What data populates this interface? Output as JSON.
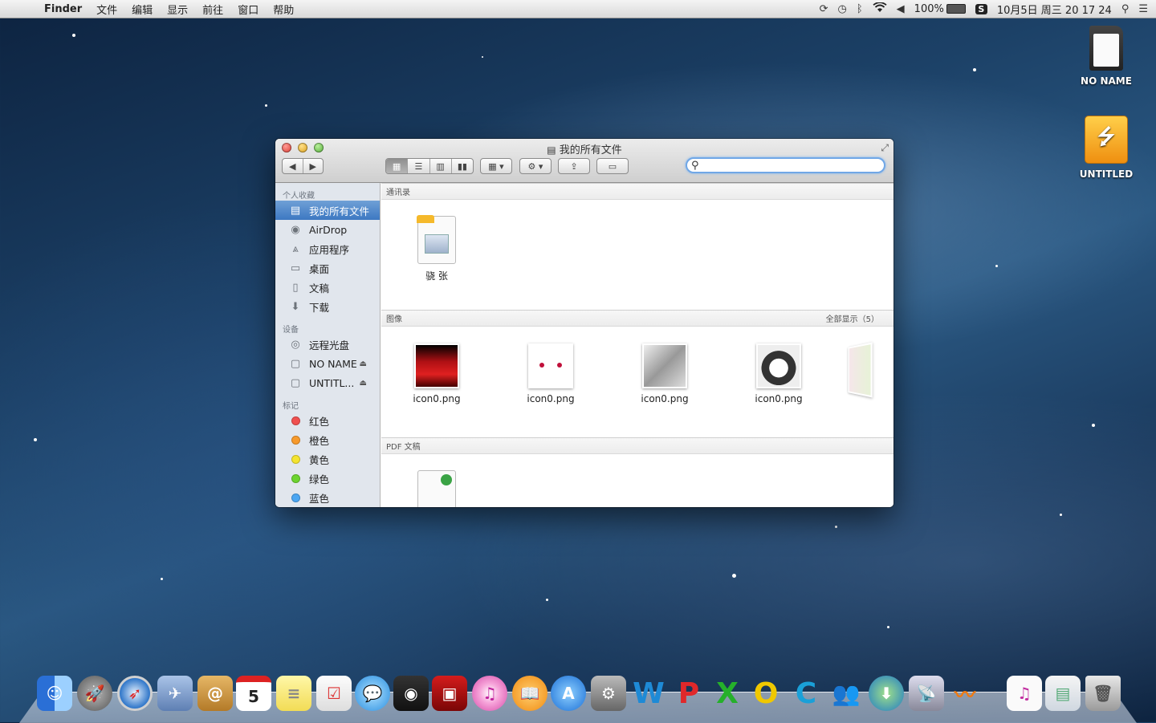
{
  "menubar": {
    "apple_glyph": "",
    "app_name": "Finder",
    "menus": [
      "文件",
      "编辑",
      "显示",
      "前往",
      "窗口",
      "帮助"
    ],
    "battery": "100%",
    "datetime": "10月5日 周三  20 17 24"
  },
  "desktop": {
    "drives": [
      {
        "label": "NO NAME",
        "icon": "sd-card-icon"
      },
      {
        "label": "UNTITLED",
        "icon": "usb-drive-icon"
      }
    ]
  },
  "finder": {
    "title": "我的所有文件",
    "search": {
      "value": "",
      "placeholder": ""
    },
    "sidebar": {
      "favorites_header": "个人收藏",
      "favorites": [
        {
          "label": "我的所有文件",
          "icon": "all-files-icon",
          "selected": true
        },
        {
          "label": "AirDrop",
          "icon": "airdrop-icon"
        },
        {
          "label": "应用程序",
          "icon": "applications-icon"
        },
        {
          "label": "桌面",
          "icon": "desktop-icon"
        },
        {
          "label": "文稿",
          "icon": "documents-icon"
        },
        {
          "label": "下载",
          "icon": "downloads-icon"
        }
      ],
      "devices_header": "设备",
      "devices": [
        {
          "label": "远程光盘",
          "icon": "remote-disc-icon"
        },
        {
          "label": "NO NAME",
          "icon": "drive-icon",
          "eject": true
        },
        {
          "label": "UNTITL...",
          "icon": "drive-icon",
          "eject": true
        }
      ],
      "tags_header": "标记",
      "tags": [
        {
          "label": "红色",
          "color": "#f0504f"
        },
        {
          "label": "橙色",
          "color": "#f79a2c"
        },
        {
          "label": "黄色",
          "color": "#f4e430"
        },
        {
          "label": "绿色",
          "color": "#6dd430"
        },
        {
          "label": "蓝色",
          "color": "#4ba6f2"
        }
      ]
    },
    "sections": {
      "contacts": {
        "header": "通讯录",
        "items": [
          {
            "label": "骁 张",
            "icon": "vcard-icon"
          }
        ]
      },
      "images": {
        "header": "图像",
        "show_all": "全部显示（5）",
        "items": [
          {
            "label": "icon0.png",
            "thumb": "red-crowd-image"
          },
          {
            "label": "icon0.png",
            "thumb": "white-face-image"
          },
          {
            "label": "icon0.png",
            "thumb": "god-eater-image"
          },
          {
            "label": "icon0.png",
            "thumb": "dog-image"
          }
        ]
      },
      "pdf": {
        "header": "PDF 文稿"
      }
    }
  },
  "dock": {
    "items": [
      "finder-icon",
      "launchpad-icon",
      "safari-icon",
      "mail-icon",
      "contacts-icon",
      "calendar-icon",
      "notes-icon",
      "reminders-icon",
      "messages-icon",
      "facetime-icon",
      "photo-booth-icon",
      "itunes-icon",
      "ibooks-icon",
      "app-store-icon",
      "system-preferences-icon",
      "word-icon",
      "powerpoint-icon",
      "excel-icon",
      "outlook-icon",
      "communicator-icon",
      "messenger-icon",
      "network-icon",
      "remote-desktop-icon",
      "xunlei-icon",
      "ipsw-document-icon",
      "preview-document-icon",
      "trash-icon"
    ],
    "calendar_day": "5"
  }
}
